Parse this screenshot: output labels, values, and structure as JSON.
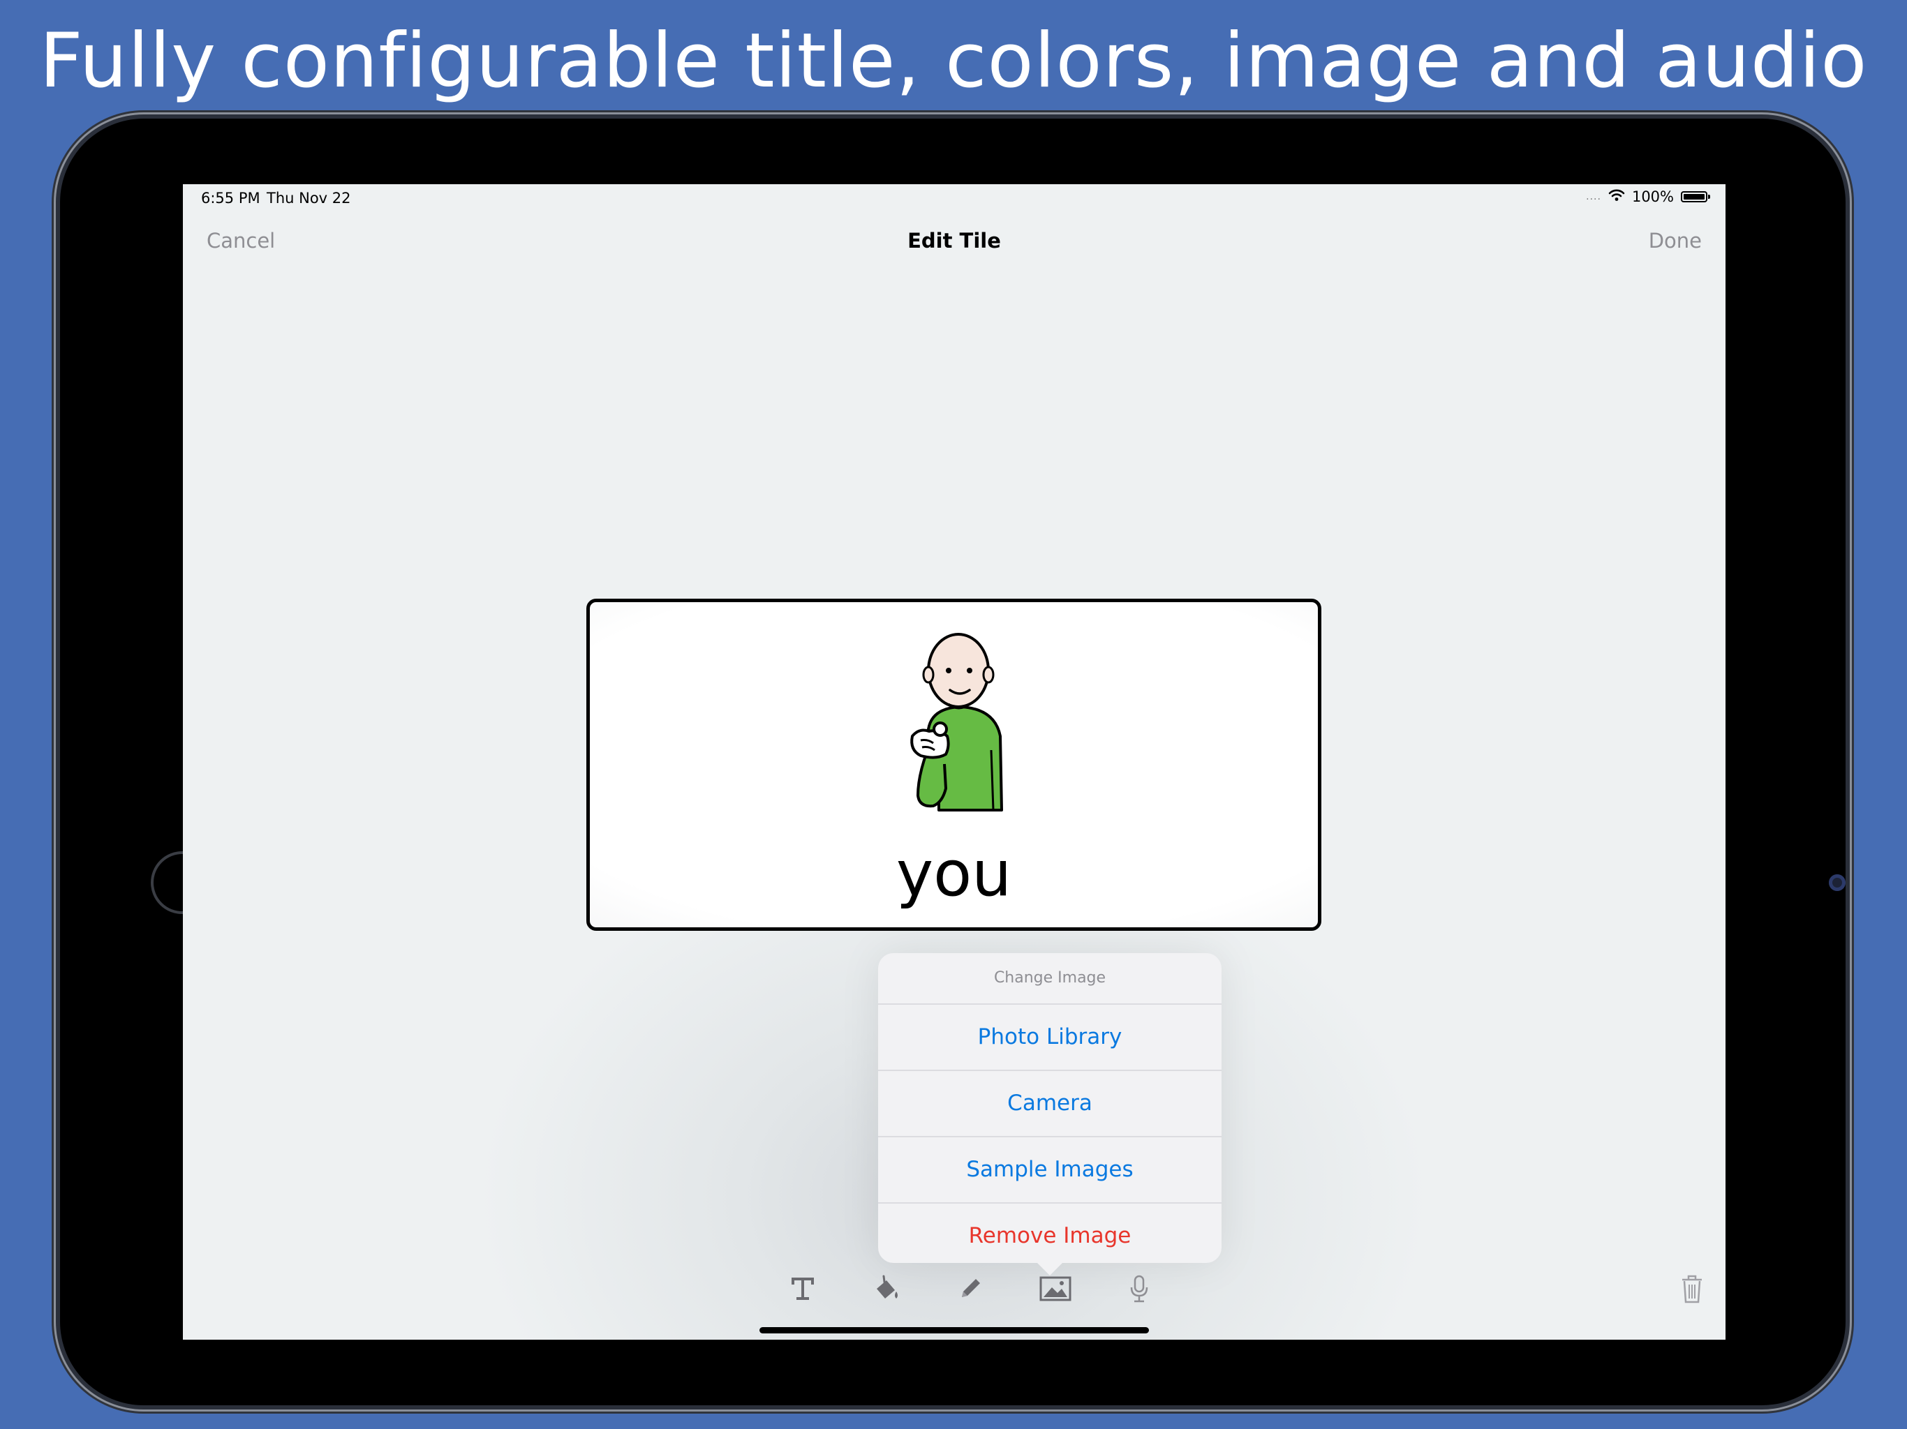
{
  "headline": "Fully configurable title, colors, image and audio",
  "status_bar": {
    "time": "6:55 PM",
    "date": "Thu Nov 22",
    "signal_dots": "....",
    "battery_percent": "100%"
  },
  "nav": {
    "cancel_label": "Cancel",
    "title": "Edit Tile",
    "done_label": "Done"
  },
  "tile": {
    "label": "you",
    "image_icon": "person-pointing-symbol",
    "shirt_color": "#66bb44",
    "border_color": "#000000"
  },
  "popover": {
    "title": "Change Image",
    "items": [
      {
        "label": "Photo Library"
      },
      {
        "label": "Camera"
      },
      {
        "label": "Sample Images"
      },
      {
        "label": "Remove Image",
        "destructive": true
      }
    ]
  },
  "toolbar": {
    "icons": [
      "text-icon",
      "paint-bucket-icon",
      "pencil-icon",
      "image-icon",
      "microphone-icon",
      "trash-icon"
    ],
    "active": "image-icon"
  },
  "colors": {
    "background": "#466db4",
    "accent": "#0a79e0",
    "destructive": "#e8362c",
    "inactive": "#8e8e93"
  }
}
